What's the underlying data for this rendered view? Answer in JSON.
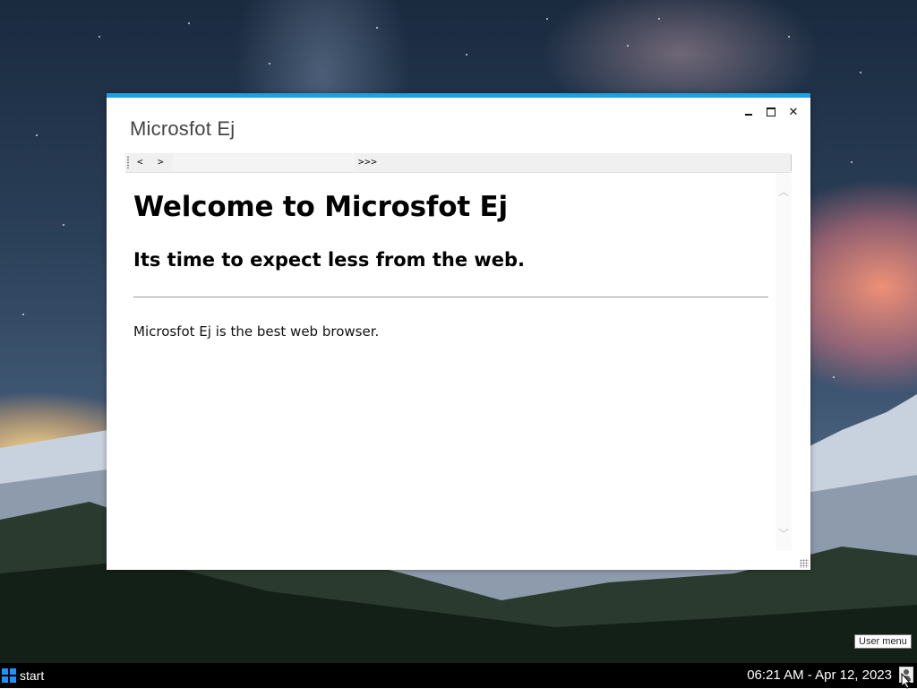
{
  "desktop": {
    "wallpaper": "night-sky-snowy-mountains",
    "colors": {
      "sky": "#2a3f58",
      "horizon_glow": "#ffd68c",
      "sunset_pink": "#f79478"
    }
  },
  "window": {
    "title": "Microsfot Ej",
    "accent_color": "#1ba1e2",
    "controls": {
      "minimize_icon": "minimize-icon",
      "maximize_icon": "maximize-icon",
      "close_label": "✕"
    },
    "nav": {
      "back_label": "<",
      "forward_label": ">",
      "url_value": "",
      "more_label": ">>>"
    },
    "page": {
      "heading": "Welcome to Microsfot Ej",
      "subheading": "Its time to expect less from the web.",
      "body": "Microsfot Ej is the best web browser."
    },
    "scroll": {
      "up_label": "︿",
      "down_label": "﹀"
    }
  },
  "taskbar": {
    "start_label": "start",
    "clock": "06:21 AM - Apr 12, 2023",
    "user_icon": "user-icon",
    "tooltip": "User menu"
  }
}
